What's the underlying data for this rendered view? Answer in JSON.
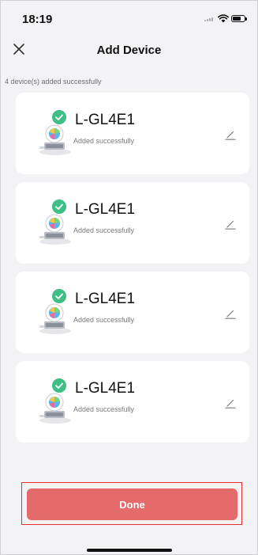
{
  "status_bar": {
    "time": "18:19",
    "battery_level": 0.7
  },
  "header": {
    "title": "Add Device",
    "close_icon": "close-icon"
  },
  "summary": "4 device(s) added successfully",
  "devices": [
    {
      "name": "L-GL4E1",
      "status": "Added successfully"
    },
    {
      "name": "L-GL4E1",
      "status": "Added successfully"
    },
    {
      "name": "L-GL4E1",
      "status": "Added successfully"
    },
    {
      "name": "L-GL4E1",
      "status": "Added successfully"
    }
  ],
  "done_button": {
    "label": "Done"
  },
  "colors": {
    "accent": "#e46a6c",
    "success": "#3fbf86",
    "highlight": "#e52e2e",
    "background": "#f3f3f5"
  }
}
